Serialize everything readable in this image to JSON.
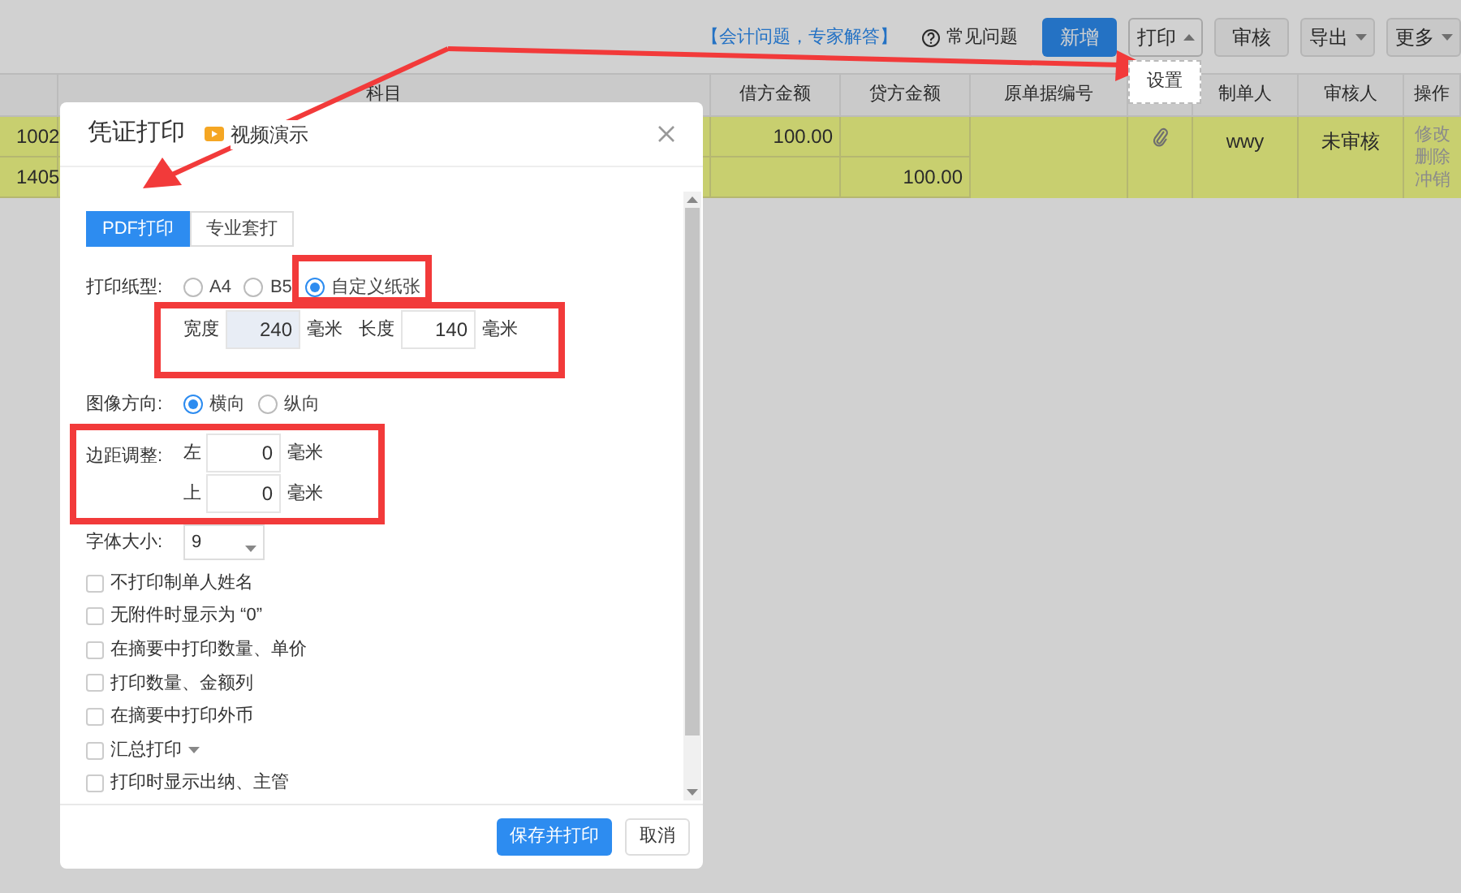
{
  "toolbar": {
    "expert_link": "【会计问题，专家解答】",
    "faq_link": "常见问题",
    "buttons": [
      {
        "label": "新增",
        "kind": "primary"
      },
      {
        "label": "打印",
        "kind": "dropdown",
        "expanded": true
      },
      {
        "label": "审核",
        "kind": "plain"
      },
      {
        "label": "导出",
        "kind": "dropdown",
        "expanded": false
      },
      {
        "label": "更多",
        "kind": "dropdown",
        "expanded": false
      }
    ],
    "print_menu": [
      "设置"
    ]
  },
  "table": {
    "columns": [
      "科目",
      "借方金额",
      "贷方金额",
      "原单据编号",
      null,
      "制单人",
      "审核人",
      "操作"
    ],
    "voucher": {
      "entries": [
        {
          "code": "1002",
          "debit": "100.00"
        },
        {
          "code": "1405",
          "credit": "100.00"
        }
      ],
      "attachment": true,
      "maker": "wwy",
      "reviewer": "未审核",
      "actions": [
        "修改",
        "删除",
        "冲销"
      ]
    }
  },
  "dialog": {
    "title": "凭证打印",
    "video_link": "视频演示",
    "tabs": [
      {
        "label": "PDF打印",
        "selected": true
      },
      {
        "label": "专业套打",
        "selected": false
      }
    ],
    "paper": {
      "label": "打印纸型:",
      "options": [
        {
          "label": "A4",
          "selected": false
        },
        {
          "label": "B5",
          "selected": false
        },
        {
          "label": "自定义纸张",
          "selected": true
        }
      ]
    },
    "size_fields": [
      {
        "label": "宽度",
        "value": "240",
        "unit": "毫米",
        "highlighted": true
      },
      {
        "label": "长度",
        "value": "140",
        "unit": "毫米",
        "highlighted": false
      }
    ],
    "orientation": {
      "label": "图像方向:",
      "options": [
        {
          "label": "横向",
          "selected": true
        },
        {
          "label": "纵向",
          "selected": false
        }
      ]
    },
    "margins": {
      "label": "边距调整:",
      "fields": [
        {
          "label": "左",
          "value": "0",
          "unit": "毫米"
        },
        {
          "label": "上",
          "value": "0",
          "unit": "毫米"
        }
      ]
    },
    "font_size": {
      "label": "字体大小:",
      "value": "9"
    },
    "checkboxes": [
      {
        "label": "不打印制单人姓名",
        "checked": false,
        "kind": "plain"
      },
      {
        "label": "无附件时显示为 “0”",
        "checked": false,
        "kind": "plain"
      },
      {
        "label": "在摘要中打印数量、单价",
        "checked": false,
        "kind": "plain"
      },
      {
        "label": "打印数量、金额列",
        "checked": false,
        "kind": "plain"
      },
      {
        "label": "在摘要中打印外币",
        "checked": false,
        "kind": "plain"
      },
      {
        "label": "汇总打印",
        "checked": false,
        "kind": "dropdown"
      },
      {
        "label": "打印时显示出纳、主管",
        "checked": false,
        "kind": "plain"
      }
    ],
    "buttons": [
      {
        "label": "保存并打印",
        "kind": "primary"
      },
      {
        "label": "取消",
        "kind": "plain"
      }
    ]
  }
}
